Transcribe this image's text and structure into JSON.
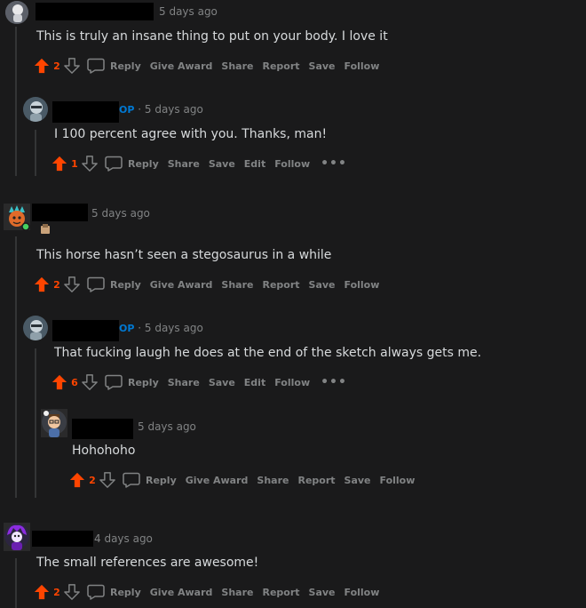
{
  "colors": {
    "upvote": "#ff4500",
    "op": "#0079d3",
    "muted": "#818384",
    "background": "#1a1a1b"
  },
  "comments": [
    {
      "author": "",
      "time": "5 days ago",
      "text": "This is truly an insane thing to put on your body. I love it",
      "score": "2",
      "actions": [
        "Reply",
        "Give Award",
        "Share",
        "Report",
        "Save",
        "Follow"
      ]
    },
    {
      "author": "",
      "op_badge": "OP",
      "time": "· 5 days ago",
      "text": "I 100 percent agree with you. Thanks, man!",
      "score": "1",
      "actions": [
        "Reply",
        "Share",
        "Save",
        "Edit",
        "Follow"
      ],
      "more": "•••"
    },
    {
      "author": "",
      "time": "5 days ago",
      "text": "This horse hasn’t seen a stegosaurus in a while",
      "score": "2",
      "actions": [
        "Reply",
        "Give Award",
        "Share",
        "Report",
        "Save",
        "Follow"
      ]
    },
    {
      "author": "",
      "op_badge": "OP",
      "time": "· 5 days ago",
      "text": "That fucking laugh he does at the end of the sketch always gets me.",
      "score": "6",
      "actions": [
        "Reply",
        "Share",
        "Save",
        "Edit",
        "Follow"
      ],
      "more": "•••"
    },
    {
      "author": "",
      "time": "5 days ago",
      "text": "Hohohoho",
      "score": "2",
      "actions": [
        "Reply",
        "Give Award",
        "Share",
        "Report",
        "Save",
        "Follow"
      ]
    },
    {
      "author": "",
      "time": "4 days ago",
      "text": "The small references are awesome!",
      "score": "2",
      "actions": [
        "Reply",
        "Give Award",
        "Share",
        "Report",
        "Save",
        "Follow"
      ]
    }
  ]
}
